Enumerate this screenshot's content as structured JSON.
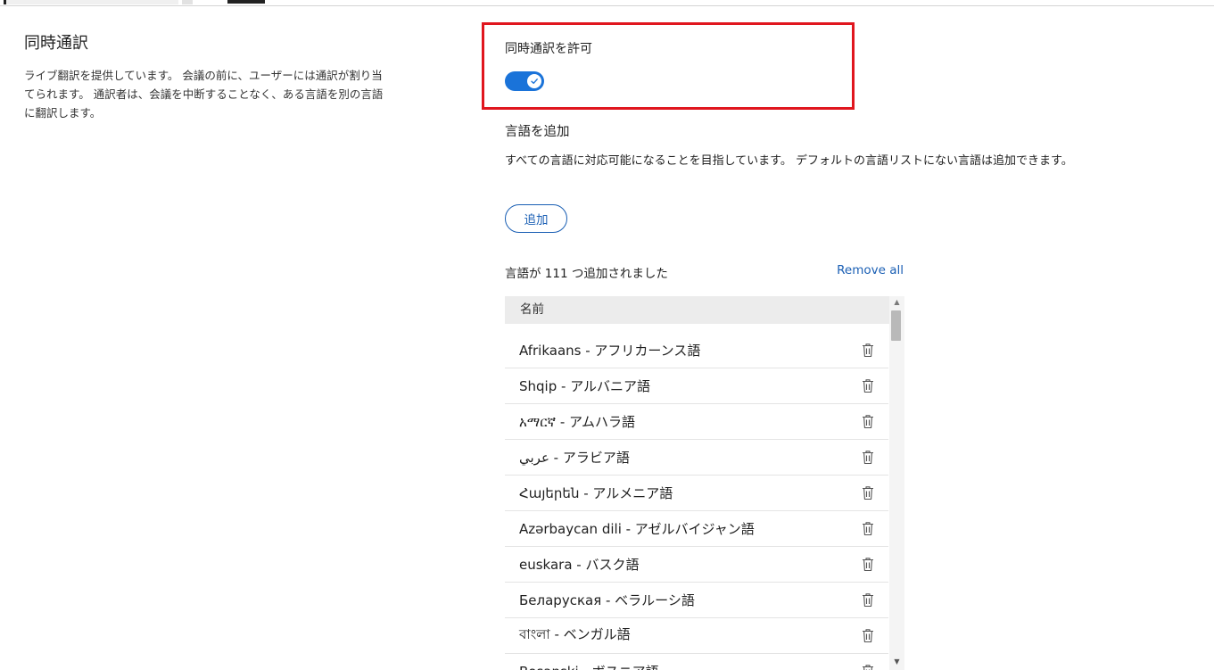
{
  "section": {
    "title": "同時通訳",
    "description": "ライブ翻訳を提供しています。 会議の前に、ユーザーには通訳が割り当てられます。 通訳者は、会議を中断することなく、ある言語を別の言語に翻訳します。"
  },
  "toggle": {
    "label": "同時通訳を許可",
    "state": "on",
    "accent_color": "#1a73d9"
  },
  "highlight_color": "#e0161e",
  "add_language": {
    "title": "言語を追加",
    "description": "すべての言語に対応可能になることを目指しています。 デフォルトの言語リストにない言語は追加できます。",
    "button_label": "追加"
  },
  "language_list": {
    "count_text": "言語が 111 つ追加されました",
    "remove_all_label": "Remove all",
    "column_header": "名前",
    "rows": [
      "Afrikaans - アフリカーンス語",
      "Shqip - アルバニア語",
      "አማርኛ - アムハラ語",
      "عربي - アラビア語",
      "Հայերեն - アルメニア語",
      "Azərbaycan dili - アゼルバイジャン語",
      "euskara - バスク語",
      "Беларуская - ベラルーシ語",
      "বাংলা - ベンガル語",
      "Bosanski - ボスニア語"
    ]
  },
  "icons": {
    "toggle": "checkmark-icon",
    "row_action": "trash-icon"
  }
}
